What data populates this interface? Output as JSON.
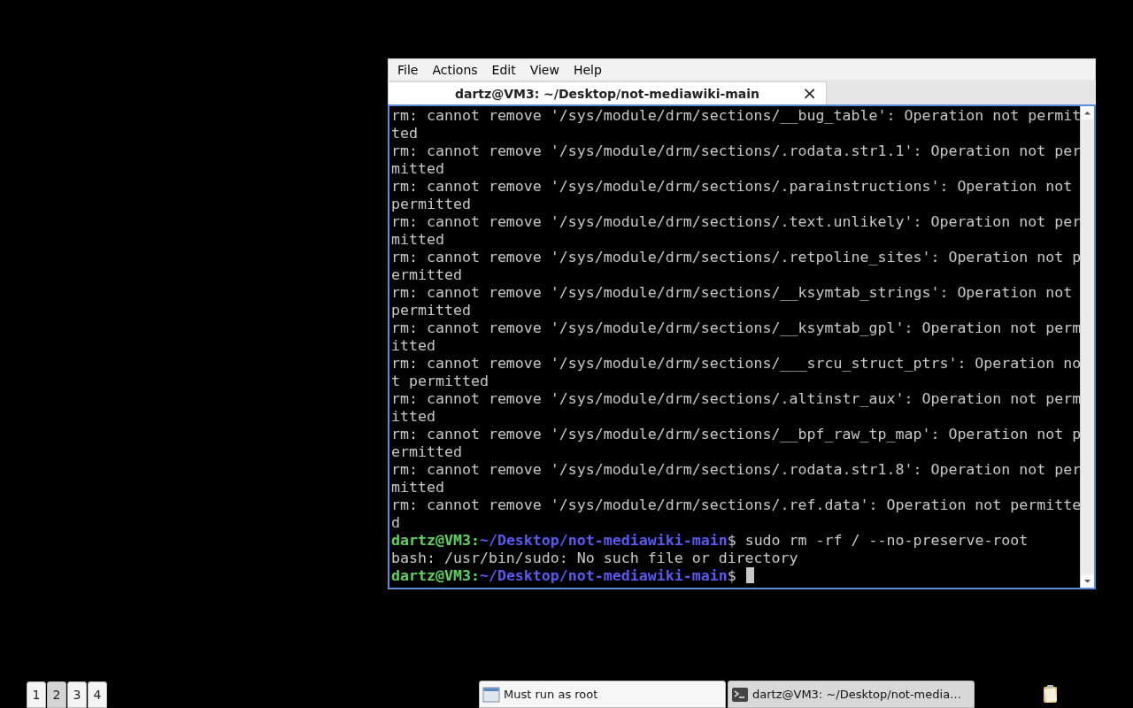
{
  "window": {
    "menu": [
      "File",
      "Actions",
      "Edit",
      "View",
      "Help"
    ],
    "tabs": [
      {
        "label": "dartz@VM3: ~/Desktop/not-mediawiki-main",
        "selected": true,
        "close": "×"
      }
    ],
    "terminal": {
      "lines": [
        {
          "kind": "output",
          "text": "rm: cannot remove '/sys/module/drm/sections/__bug_table': Operation not permit"
        },
        {
          "kind": "output",
          "text": "ted"
        },
        {
          "kind": "output",
          "text": "rm: cannot remove '/sys/module/drm/sections/.rodata.str1.1': Operation not per"
        },
        {
          "kind": "output",
          "text": "mitted"
        },
        {
          "kind": "output",
          "text": "rm: cannot remove '/sys/module/drm/sections/.parainstructions': Operation not"
        },
        {
          "kind": "output",
          "text": "permitted"
        },
        {
          "kind": "output",
          "text": "rm: cannot remove '/sys/module/drm/sections/.text.unlikely': Operation not per"
        },
        {
          "kind": "output",
          "text": "mitted"
        },
        {
          "kind": "output",
          "text": "rm: cannot remove '/sys/module/drm/sections/.retpoline_sites': Operation not p"
        },
        {
          "kind": "output",
          "text": "ermitted"
        },
        {
          "kind": "output",
          "text": "rm: cannot remove '/sys/module/drm/sections/__ksymtab_strings': Operation not"
        },
        {
          "kind": "output",
          "text": "permitted"
        },
        {
          "kind": "output",
          "text": "rm: cannot remove '/sys/module/drm/sections/__ksymtab_gpl': Operation not perm"
        },
        {
          "kind": "output",
          "text": "itted"
        },
        {
          "kind": "output",
          "text": "rm: cannot remove '/sys/module/drm/sections/___srcu_struct_ptrs': Operation no"
        },
        {
          "kind": "output",
          "text": "t permitted"
        },
        {
          "kind": "output",
          "text": "rm: cannot remove '/sys/module/drm/sections/.altinstr_aux': Operation not perm"
        },
        {
          "kind": "output",
          "text": "itted"
        },
        {
          "kind": "output",
          "text": "rm: cannot remove '/sys/module/drm/sections/__bpf_raw_tp_map': Operation not p"
        },
        {
          "kind": "output",
          "text": "ermitted"
        },
        {
          "kind": "output",
          "text": "rm: cannot remove '/sys/module/drm/sections/.rodata.str1.8': Operation not per"
        },
        {
          "kind": "output",
          "text": "mitted"
        },
        {
          "kind": "output",
          "text": "rm: cannot remove '/sys/module/drm/sections/.ref.data': Operation not permitte"
        },
        {
          "kind": "output",
          "text": "d"
        },
        {
          "kind": "prompt",
          "user": "dartz@VM3:",
          "path": "~/Desktop/not-mediawiki-main",
          "sign": "$",
          "command": "sudo rm -rf / --no-preserve-root"
        },
        {
          "kind": "output",
          "text": "bash: /usr/bin/sudo: No such file or directory"
        },
        {
          "kind": "prompt",
          "user": "dartz@VM3:",
          "path": "~/Desktop/not-mediawiki-main",
          "sign": "$",
          "cursor": true
        }
      ]
    }
  },
  "taskbar": {
    "workspaces": [
      {
        "label": "1",
        "selected": false
      },
      {
        "label": "2",
        "selected": true
      },
      {
        "label": "3",
        "selected": false
      },
      {
        "label": "4",
        "selected": false
      }
    ],
    "tasks": [
      {
        "kind": "window",
        "label": "Must run as root",
        "selected": false
      },
      {
        "kind": "terminal",
        "label": "dartz@VM3: ~/Desktop/not-media…",
        "selected": true
      }
    ]
  }
}
